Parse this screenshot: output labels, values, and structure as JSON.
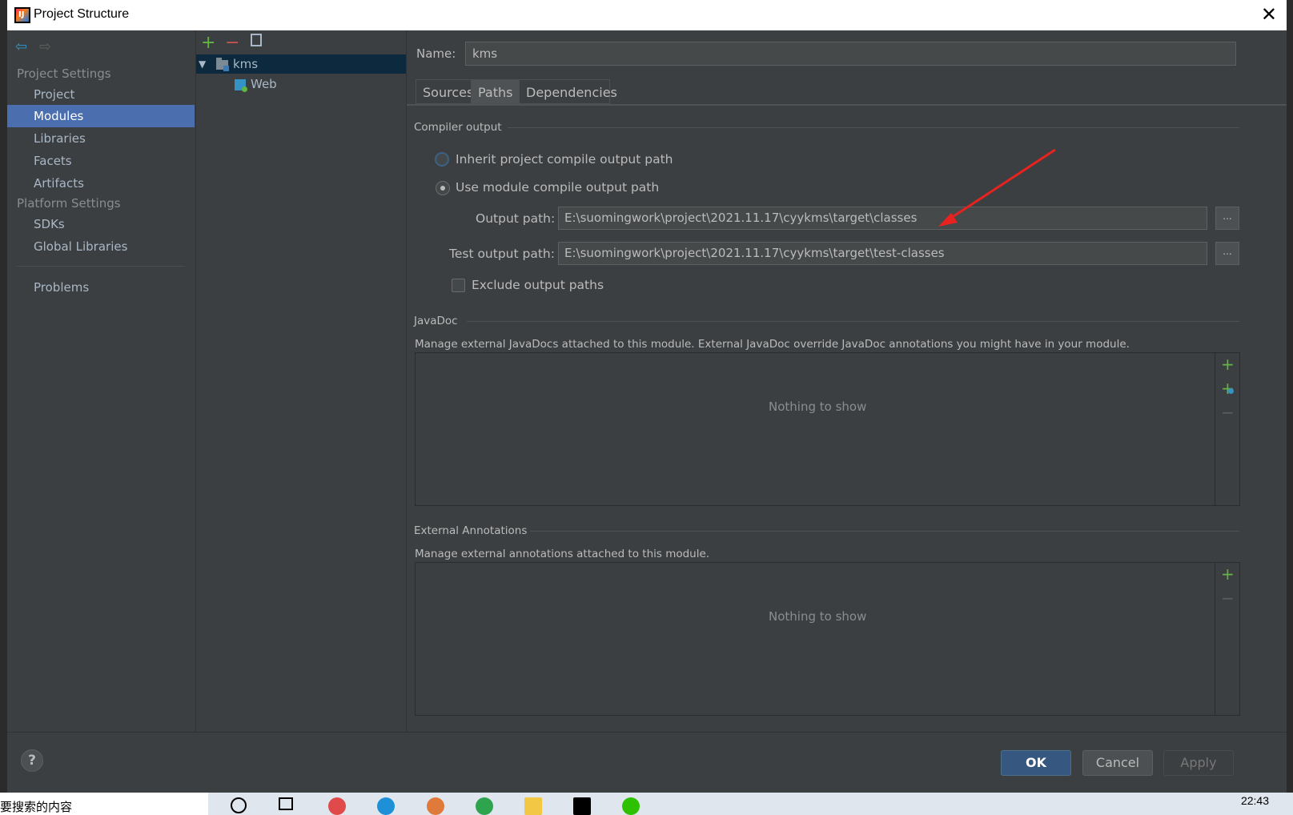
{
  "window": {
    "title": "Project Structure"
  },
  "nav": {
    "project_settings_header": "Project Settings",
    "platform_settings_header": "Platform Settings",
    "items_project": [
      {
        "label": "Project"
      },
      {
        "label": "Modules",
        "selected": true
      },
      {
        "label": "Libraries"
      },
      {
        "label": "Facets"
      },
      {
        "label": "Artifacts"
      }
    ],
    "items_platform": [
      {
        "label": "SDKs"
      },
      {
        "label": "Global Libraries"
      }
    ],
    "problems_label": "Problems"
  },
  "tree": {
    "root": "kms",
    "child": "Web"
  },
  "module": {
    "name_label": "Name:",
    "name_value": "kms",
    "tabs": [
      {
        "label": "Sources"
      },
      {
        "label": "Paths",
        "selected": true
      },
      {
        "label": "Dependencies"
      }
    ]
  },
  "compiler_output": {
    "title": "Compiler output",
    "inherit_label": "Inherit project compile output path",
    "use_module_label": "Use module compile output path",
    "selected_option": "use_module",
    "output_path_label": "Output path:",
    "output_path_value": "E:\\suomingwork\\project\\2021.11.17\\cyykms\\target\\classes",
    "test_output_path_label": "Test output path:",
    "test_output_path_value": "E:\\suomingwork\\project\\2021.11.17\\cyykms\\target\\test-classes",
    "browse_label": "...",
    "exclude_label": "Exclude output paths",
    "exclude_checked": false
  },
  "javadoc": {
    "title": "JavaDoc",
    "description": "Manage external JavaDocs attached to this module. External JavaDoc override JavaDoc annotations you might have in your module.",
    "empty": "Nothing to show"
  },
  "external_annotations": {
    "title": "External Annotations",
    "description": "Manage external annotations attached to this module.",
    "empty": "Nothing to show"
  },
  "buttons": {
    "help": "?",
    "ok": "OK",
    "cancel": "Cancel",
    "apply": "Apply"
  },
  "taskbar": {
    "search_text": "要搜索的内容",
    "time": "22:43"
  },
  "colors": {
    "background": "#3c3f41",
    "selection": "#4b6eaf",
    "ok_button": "#365880",
    "add_icon": "#62b543",
    "annotation_arrow": "#e8231f"
  }
}
